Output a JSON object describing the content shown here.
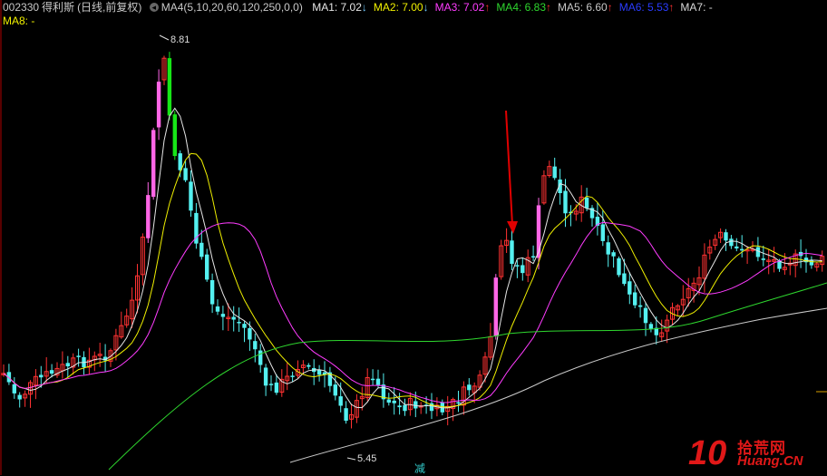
{
  "legend": {
    "code": "002330",
    "name": "得利斯",
    "desc": "(日线,前复权)",
    "indicator": "MA4(5,10,20,60,120,250,0,0)",
    "items": [
      {
        "label": "MA1: 7.02",
        "arrow": "↓",
        "color": "#e6e6e6",
        "arrow_color": "#6ec8ff"
      },
      {
        "label": "MA2: 7.00",
        "arrow": "↓",
        "color": "#f0f000",
        "arrow_color": "#6ec8ff"
      },
      {
        "label": "MA3: 7.02",
        "arrow": "↑",
        "color": "#ff3cff",
        "arrow_color": "#ff3232"
      },
      {
        "label": "MA4: 6.83",
        "arrow": "↑",
        "color": "#2ed62e",
        "arrow_color": "#ff3232"
      },
      {
        "label": "MA5: 6.60",
        "arrow": "↑",
        "color": "#c8c8c8",
        "arrow_color": "#ff3232"
      },
      {
        "label": "MA6: 5.53",
        "arrow": "↑",
        "color": "#2a3cff",
        "arrow_color": "#ff3232"
      },
      {
        "label": "MA7: -",
        "arrow": "",
        "color": "#d8d8d8",
        "arrow_color": "#ff3232"
      }
    ],
    "row2": "MA8: -",
    "row2_color": "#f0f000"
  },
  "labels": {
    "high": "8.81",
    "low": "5.45",
    "marker": "减"
  },
  "watermark": {
    "ten": "10",
    "cn": "拾荒网",
    "url": "Huang.CN"
  },
  "colors": {
    "up": "#ff3232",
    "down": "#54f0f0",
    "limit_up": "#ff66e6",
    "limit_down": "#17e617",
    "ma1": "#e6e6e6",
    "ma2": "#f0f000",
    "ma3": "#ff3cff",
    "ma4": "#2ed62e",
    "ma5": "#c8c8c8",
    "annotation": "#e00000"
  }
}
